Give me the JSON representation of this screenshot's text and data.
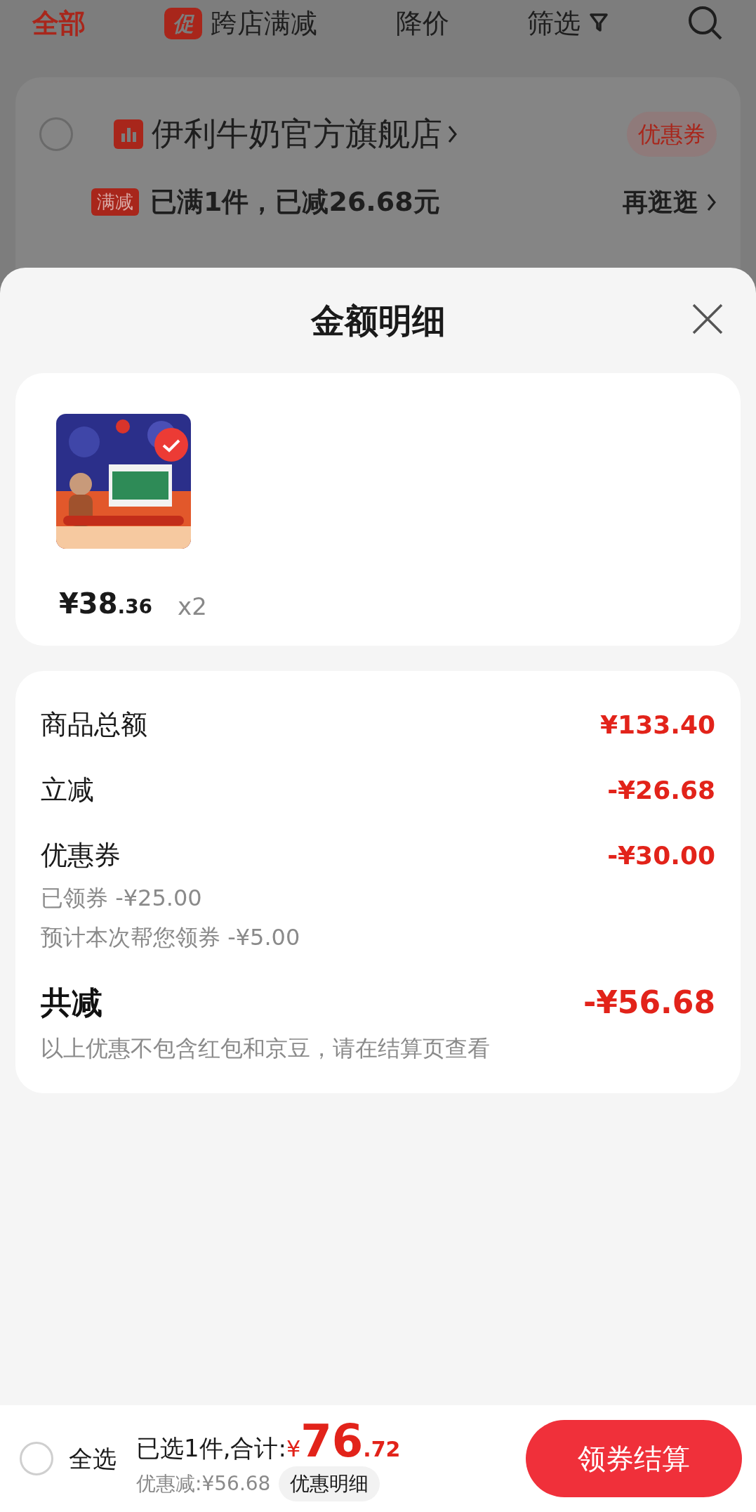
{
  "top_tabs": [
    {
      "label": "全部",
      "selected": true
    },
    {
      "label": "跨店满减",
      "badge": "促",
      "selected": false
    },
    {
      "label": "降价",
      "selected": false
    },
    {
      "label": "筛选",
      "kind": "filter",
      "selected": false
    }
  ],
  "store": {
    "name": "伊利牛奶官方旗舰店",
    "checked": false,
    "coupon_button": "优惠券",
    "promo_tag": "满减",
    "promo_text": "已满1件，已减26.68元",
    "more_link": "再逛逛"
  },
  "sheet": {
    "title": "金额明细",
    "items": [
      {
        "price_int": "¥38",
        "price_dec": ".36",
        "qty": "x2",
        "checked": true
      }
    ],
    "rows": [
      {
        "kind": "row",
        "label": "商品总额",
        "value": "¥133.40"
      },
      {
        "kind": "row",
        "label": "立减",
        "value": "-¥26.68"
      },
      {
        "kind": "row",
        "label": "优惠券",
        "value": "-¥30.00",
        "notes": [
          "已领券 -¥25.00",
          "预计本次帮您领券 -¥5.00"
        ]
      },
      {
        "kind": "total",
        "label": "共减",
        "value": "-¥56.68",
        "notes": [
          "以上优惠不包含红包和京豆，请在结算页查看"
        ]
      }
    ]
  },
  "bottom": {
    "select_all": {
      "label": "全选",
      "checked": false
    },
    "selected_text": "已选1件,合计:",
    "currency": "¥",
    "total_int": "76",
    "total_dec": ".72",
    "discount": "优惠减:¥56.68",
    "detail_button": "优惠明细",
    "checkout_button": "领券结算"
  }
}
